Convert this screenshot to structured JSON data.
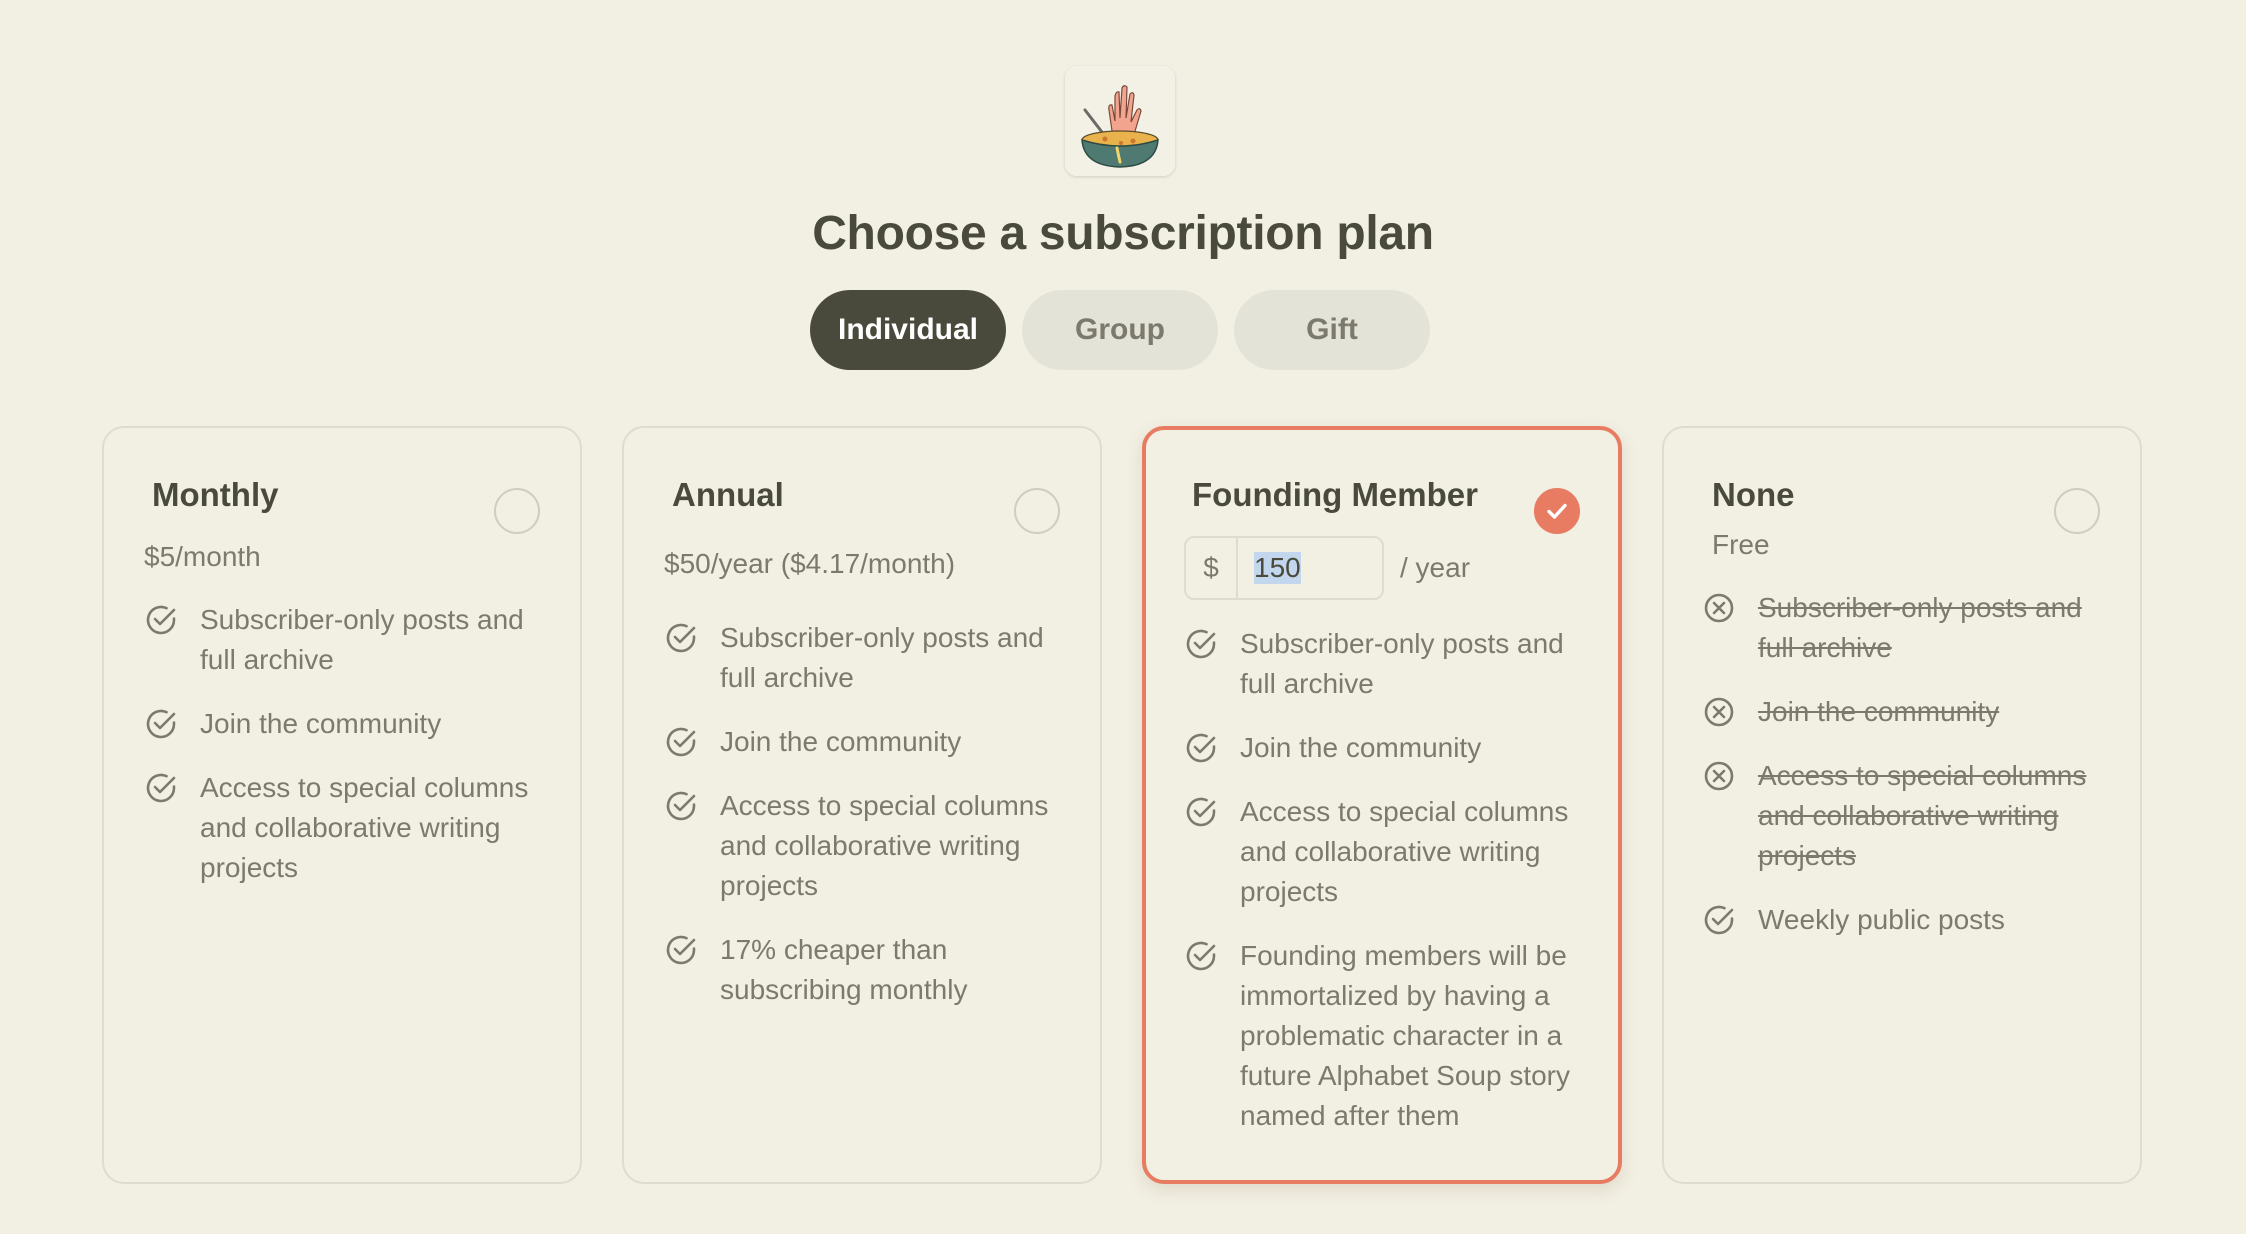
{
  "header": {
    "title": "Choose a subscription plan",
    "logo_icon": "soup-bowl-hand-logo"
  },
  "tabs": [
    {
      "label": "Individual",
      "active": true
    },
    {
      "label": "Group",
      "active": false
    },
    {
      "label": "Gift",
      "active": false
    }
  ],
  "colors": {
    "background": "#f2f0e3",
    "accent": "#e87c62",
    "dark": "#4a4a3c",
    "muted_text": "#7b7a6c"
  },
  "plans": [
    {
      "name": "Monthly",
      "price": "$5/month",
      "selected": false,
      "features": [
        {
          "text": "Subscriber-only posts and full archive",
          "included": true
        },
        {
          "text": "Join the community",
          "included": true
        },
        {
          "text": "Access to special columns and collaborative writing projects",
          "included": true
        }
      ]
    },
    {
      "name": "Annual",
      "price": "$50/year ($4.17/month)",
      "selected": false,
      "features": [
        {
          "text": "Subscriber-only posts and full archive",
          "included": true
        },
        {
          "text": "Join the community",
          "included": true
        },
        {
          "text": "Access to special columns and collaborative writing projects",
          "included": true
        },
        {
          "text": "17% cheaper than subscribing monthly",
          "included": true
        }
      ]
    },
    {
      "name": "Founding Member",
      "currency_symbol": "$",
      "amount": "150",
      "period": "/ year",
      "selected": true,
      "features": [
        {
          "text": "Subscriber-only posts and full archive",
          "included": true
        },
        {
          "text": "Join the community",
          "included": true
        },
        {
          "text": "Access to special columns and collaborative writing projects",
          "included": true
        },
        {
          "text": "Founding members will be immortalized by having a problematic character in a future Alphabet Soup story named after them",
          "included": true
        }
      ]
    },
    {
      "name": "None",
      "price": "Free",
      "selected": false,
      "features": [
        {
          "text": "Subscriber-only posts and full archive",
          "included": false
        },
        {
          "text": "Join the community",
          "included": false
        },
        {
          "text": "Access to special columns and collaborative writing projects",
          "included": false
        },
        {
          "text": "Weekly public posts",
          "included": true
        }
      ]
    }
  ]
}
